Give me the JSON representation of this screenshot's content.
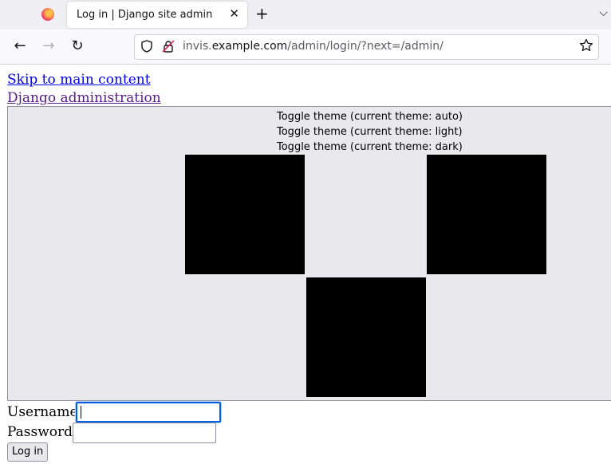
{
  "browser": {
    "tab_title": "Log in | Django site admin",
    "tab_close_glyph": "✕",
    "new_tab_glyph": "+",
    "tab_list_glyph": "⌵",
    "back_glyph": "←",
    "forward_glyph": "→",
    "reload_glyph": "↻",
    "url_prefix": "invis.",
    "url_host": "example.com",
    "url_path": "/admin/login/?next=/admin/",
    "icons": [
      "firefox-logo-icon",
      "close-icon",
      "plus-icon",
      "chevron-down-icon",
      "back-arrow-icon",
      "forward-arrow-icon",
      "reload-icon",
      "shield-icon",
      "insecure-lock-icon",
      "star-icon"
    ]
  },
  "page": {
    "skip_link": "Skip to main content",
    "site_link": "Django administration",
    "theme_toggles": [
      "Toggle theme (current theme: auto)",
      "Toggle theme (current theme: light)",
      "Toggle theme (current theme: dark)"
    ],
    "username_label": "Username:",
    "username_value": "",
    "password_label": "Password:",
    "password_value": "",
    "submit_label": "Log in"
  },
  "colors": {
    "link": "#0000ee",
    "visited_link": "#551a8b",
    "focus": "#0060df",
    "header_bg": "#e9e8ed"
  }
}
